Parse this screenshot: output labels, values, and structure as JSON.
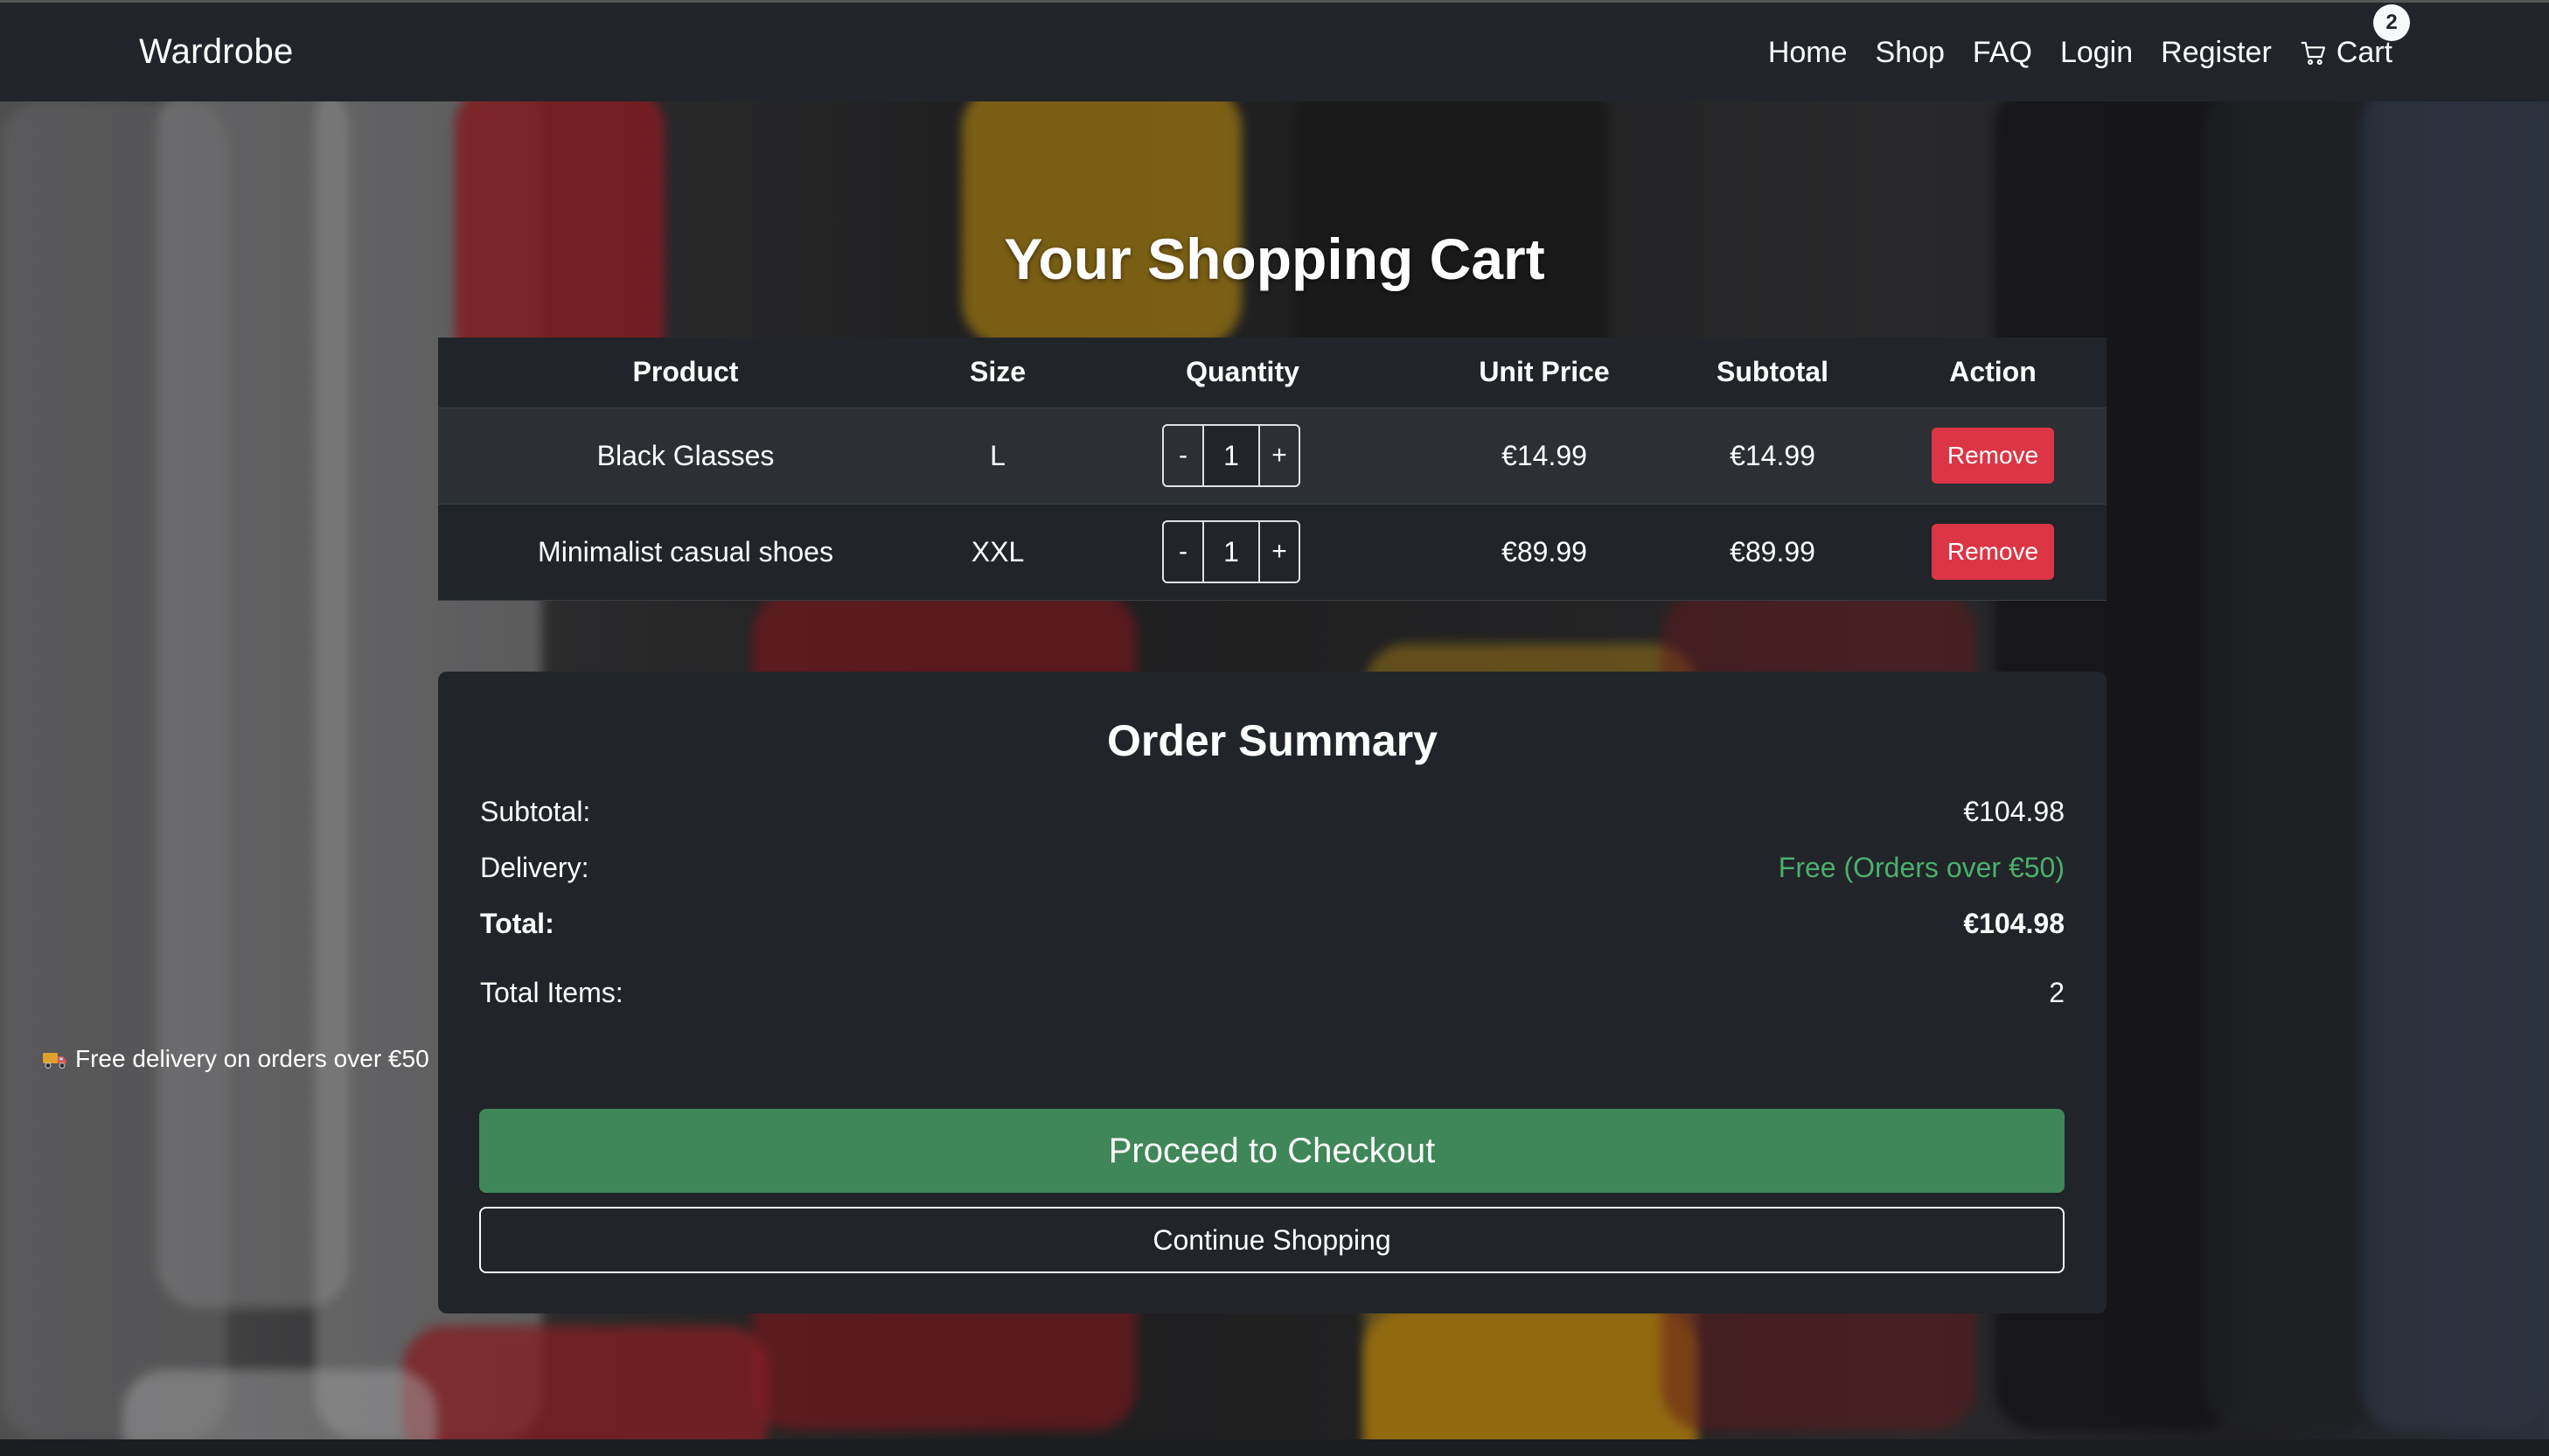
{
  "nav": {
    "brand": "Wardrobe",
    "links": [
      "Home",
      "Shop",
      "FAQ",
      "Login",
      "Register"
    ],
    "cart_label": "Cart",
    "cart_count": "2"
  },
  "page": {
    "title": "Your Shopping Cart"
  },
  "cart_table": {
    "headers": [
      "Product",
      "Size",
      "Quantity",
      "Unit Price",
      "Subtotal",
      "Action"
    ],
    "rows": [
      {
        "product": "Black Glasses",
        "size": "L",
        "quantity": "1",
        "unit_price": "€14.99",
        "subtotal": "€14.99",
        "action": "Remove"
      },
      {
        "product": "Minimalist casual shoes",
        "size": "XXL",
        "quantity": "1",
        "unit_price": "€89.99",
        "subtotal": "€89.99",
        "action": "Remove"
      }
    ],
    "minus_label": "-",
    "plus_label": "+"
  },
  "summary": {
    "title": "Order Summary",
    "subtotal_label": "Subtotal:",
    "subtotal_value": "€104.98",
    "delivery_label": "Delivery:",
    "delivery_value": "Free (Orders over €50)",
    "total_label": "Total:",
    "total_value": "€104.98",
    "items_label": "Total Items:",
    "items_value": "2",
    "note": "Free delivery on orders over €50",
    "checkout_label": "Proceed to Checkout",
    "continue_label": "Continue Shopping"
  },
  "colors": {
    "navbar": "#212529",
    "remove": "#dc3545",
    "checkout": "#3f8658",
    "free_delivery": "#4caf6e"
  },
  "icons": {
    "cart": "cart-icon",
    "delivery": "truck-icon"
  }
}
